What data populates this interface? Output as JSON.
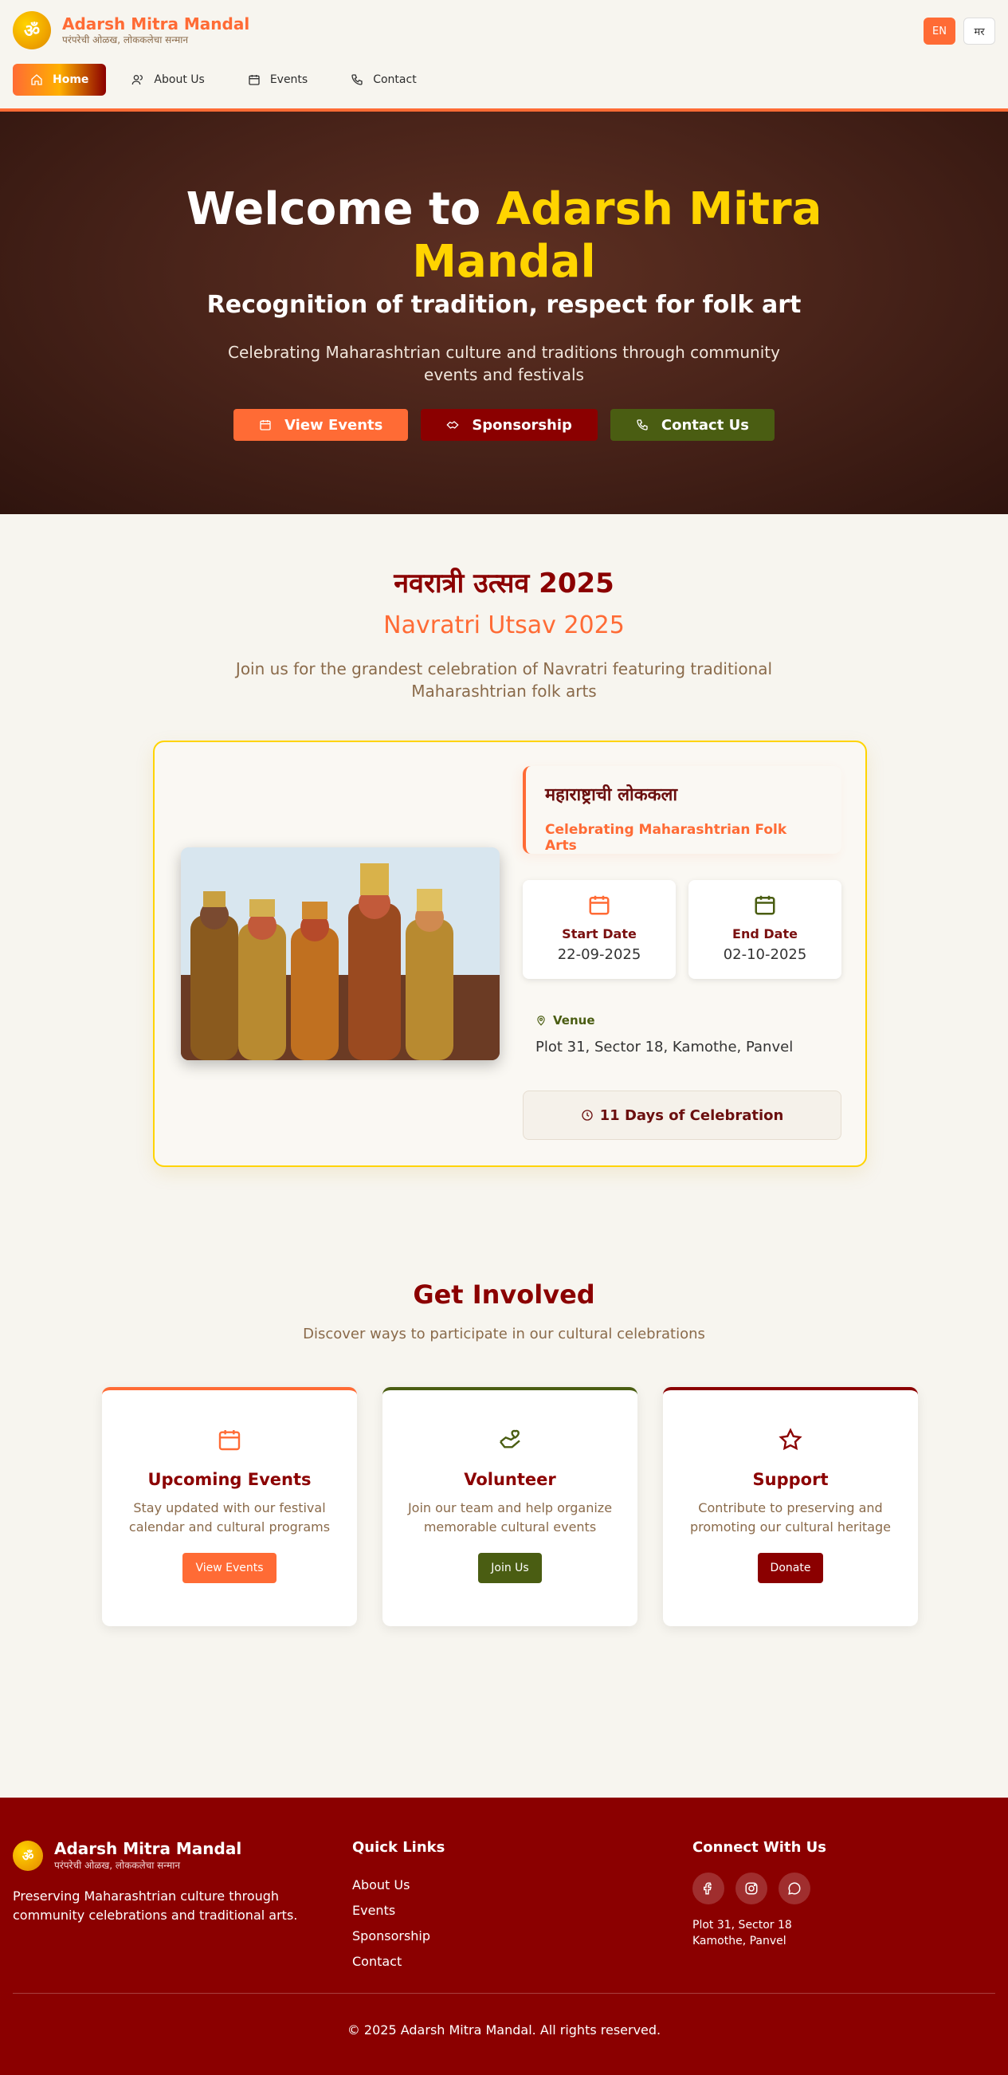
{
  "header": {
    "logo_glyph": "ॐ",
    "brand_title": "Adarsh Mitra Mandal",
    "brand_subtitle": "परंपरेची ओळख, लोककलेचा सन्मान",
    "lang": {
      "en": "EN",
      "mr": "मर"
    },
    "nav": [
      {
        "label": "Home",
        "icon": "home-icon",
        "active": true
      },
      {
        "label": "About Us",
        "icon": "users-icon"
      },
      {
        "label": "Events",
        "icon": "calendar-icon"
      },
      {
        "label": "Contact",
        "icon": "phone-icon"
      }
    ]
  },
  "hero": {
    "title_prefix": "Welcome to ",
    "title_highlight": "Adarsh Mitra Mandal",
    "tagline": "Recognition of tradition, respect for folk art",
    "description": "Celebrating Maharashtrian culture and traditions through community events and festivals",
    "buttons": {
      "events": "View Events",
      "sponsorship": "Sponsorship",
      "contact": "Contact Us"
    }
  },
  "navratri": {
    "title_mr": "नवरात्री उत्सव 2025",
    "title_en": "Navratri Utsav 2025",
    "description": "Join us for the grandest celebration of Navratri featuring traditional Maharashtrian folk arts",
    "card": {
      "heading_mr": "महाराष्ट्राची लोककला",
      "heading_en": "Celebrating Maharashtrian Folk Arts",
      "start_label": "Start Date",
      "start_value": "22-09-2025",
      "end_label": "End Date",
      "end_value": "02-10-2025",
      "venue_label": "Venue",
      "venue_value": "Plot 31, Sector 18, Kamothe, Panvel",
      "duration": "11 Days of Celebration"
    }
  },
  "involved": {
    "title": "Get Involved",
    "subtitle": "Discover ways to participate in our cultural celebrations",
    "cards": [
      {
        "title": "Upcoming Events",
        "text": "Stay updated with our festival calendar and cultural programs",
        "button": "View Events",
        "icon": "calendar-icon"
      },
      {
        "title": "Volunteer",
        "text": "Join our team and help organize memorable cultural events",
        "button": "Join Us",
        "icon": "hand-heart-icon"
      },
      {
        "title": "Support",
        "text": "Contribute to preserving and promoting our cultural heritage",
        "button": "Donate",
        "icon": "star-icon"
      }
    ]
  },
  "footer": {
    "brand_title": "Adarsh Mitra Mandal",
    "brand_subtitle": "परंपरेची ओळख, लोककलेचा सन्मान",
    "description": "Preserving Maharashtrian culture through community celebrations and traditional arts.",
    "quick_links_title": "Quick Links",
    "quick_links": [
      "About Us",
      "Events",
      "Sponsorship",
      "Contact"
    ],
    "connect_title": "Connect With Us",
    "address_line1": "Plot 31, Sector 18",
    "address_line2": "Kamothe, Panvel",
    "copyright": "© 2025 Adarsh Mitra Mandal. All rights reserved."
  },
  "colors": {
    "saffron": "#ff6b35",
    "gold": "#ffd400",
    "maroon": "#8b0000",
    "olive": "#4a5d12"
  }
}
